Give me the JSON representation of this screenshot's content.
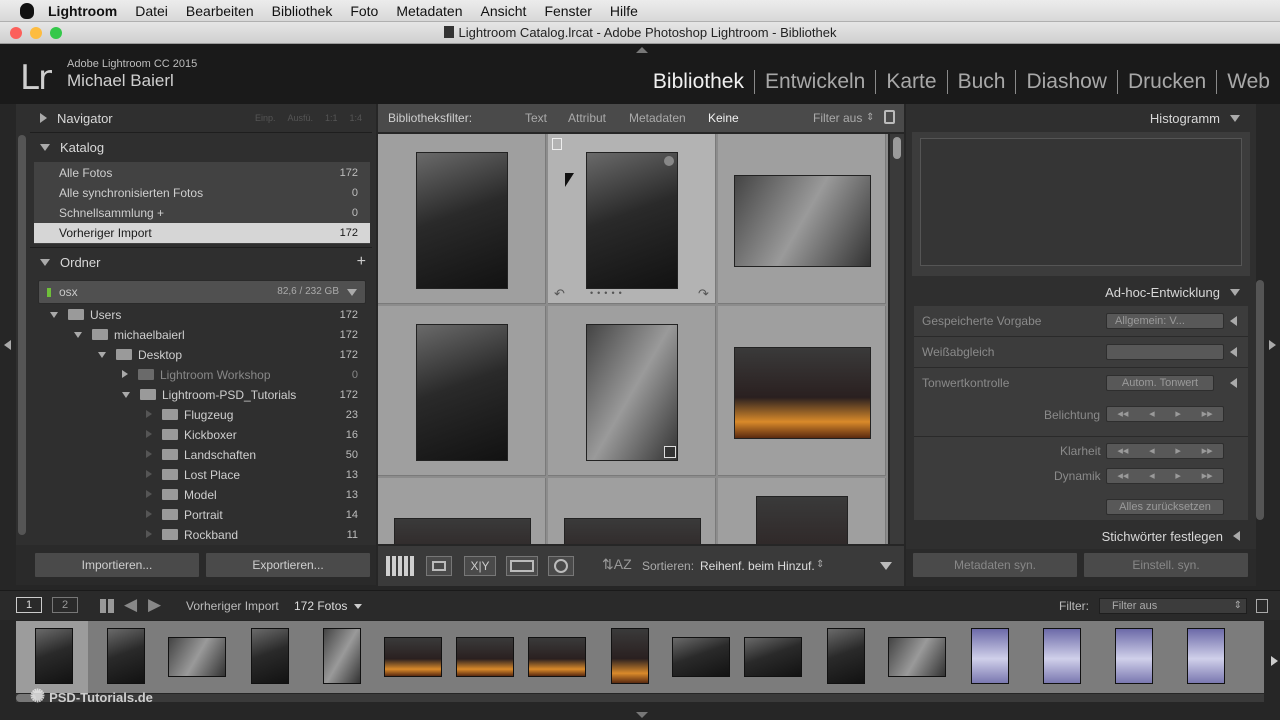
{
  "menubar": {
    "app": "Lightroom",
    "items": [
      "Datei",
      "Bearbeiten",
      "Bibliothek",
      "Foto",
      "Metadaten",
      "Ansicht",
      "Fenster",
      "Hilfe"
    ]
  },
  "window": {
    "title": "Lightroom Catalog.lrcat - Adobe Photoshop Lightroom - Bibliothek"
  },
  "identity": {
    "logo": "Lr",
    "product": "Adobe Lightroom CC 2015",
    "user": "Michael Baierl"
  },
  "modules": [
    {
      "label": "Bibliothek",
      "active": true
    },
    {
      "label": "Entwickeln"
    },
    {
      "label": "Karte"
    },
    {
      "label": "Buch"
    },
    {
      "label": "Diashow"
    },
    {
      "label": "Drucken"
    },
    {
      "label": "Web"
    }
  ],
  "left": {
    "navigator": {
      "title": "Navigator",
      "options": [
        "Einp.",
        "Ausfü.",
        "1:1",
        "1:4"
      ]
    },
    "catalog": {
      "title": "Katalog",
      "items": [
        {
          "label": "Alle Fotos",
          "count": "172"
        },
        {
          "label": "Alle synchronisierten Fotos",
          "count": "0"
        },
        {
          "label": "Schnellsammlung +",
          "count": "0"
        },
        {
          "label": "Vorheriger Import",
          "count": "172",
          "selected": true
        }
      ]
    },
    "folders": {
      "title": "Ordner",
      "add": "+",
      "volume": {
        "name": "osx",
        "size": "82,6 / 232 GB"
      },
      "items": [
        {
          "label": "Users",
          "count": "172",
          "level": 0
        },
        {
          "label": "michaelbaierl",
          "count": "172",
          "level": 1
        },
        {
          "label": "Desktop",
          "count": "172",
          "level": 2
        },
        {
          "label": "Lightroom Workshop",
          "count": "0",
          "level": 3,
          "missing": true
        },
        {
          "label": "Lightroom-PSD_Tutorials",
          "count": "172",
          "level": 3
        },
        {
          "label": "Flugzeug",
          "count": "23",
          "level": 4
        },
        {
          "label": "Kickboxer",
          "count": "16",
          "level": 4
        },
        {
          "label": "Landschaften",
          "count": "50",
          "level": 4
        },
        {
          "label": "Lost Place",
          "count": "13",
          "level": 4
        },
        {
          "label": "Model",
          "count": "13",
          "level": 4
        },
        {
          "label": "Portrait",
          "count": "14",
          "level": 4
        },
        {
          "label": "Rockband",
          "count": "11",
          "level": 4
        }
      ]
    },
    "import_label": "Importieren...",
    "export_label": "Exportieren..."
  },
  "filterbar": {
    "label": "Bibliotheksfilter:",
    "items": [
      "Text",
      "Attribut",
      "Metadaten",
      "Keine"
    ],
    "active": "Keine",
    "preset": "Filter aus"
  },
  "toolbar": {
    "sort_label": "Sortieren:",
    "sort_value": "Reihenf. beim Hinzuf."
  },
  "right": {
    "histogram": {
      "title": "Histogramm"
    },
    "quick": {
      "title": "Ad-hoc-Entwicklung",
      "saved_preset_label": "Gespeicherte Vorgabe",
      "saved_preset_value": "Allgemein: V...",
      "wb_label": "Weißabgleich",
      "tone_label": "Tonwertkontrolle",
      "tone_btn": "Autom. Tonwert",
      "exposure_label": "Belichtung",
      "clarity_label": "Klarheit",
      "vibrance_label": "Dynamik",
      "reset_label": "Alles zurücksetzen"
    },
    "keywords": {
      "title": "Stichwörter festlegen"
    },
    "sync_meta": "Metadaten syn.",
    "sync_settings": "Einstell. syn."
  },
  "filmstrip": {
    "page1": "1",
    "page2": "2",
    "source": "Vorheriger Import",
    "count": "172 Fotos",
    "filter_label": "Filter:",
    "filter_value": "Filter aus"
  },
  "watermark": "PSD-Tutorials.de"
}
